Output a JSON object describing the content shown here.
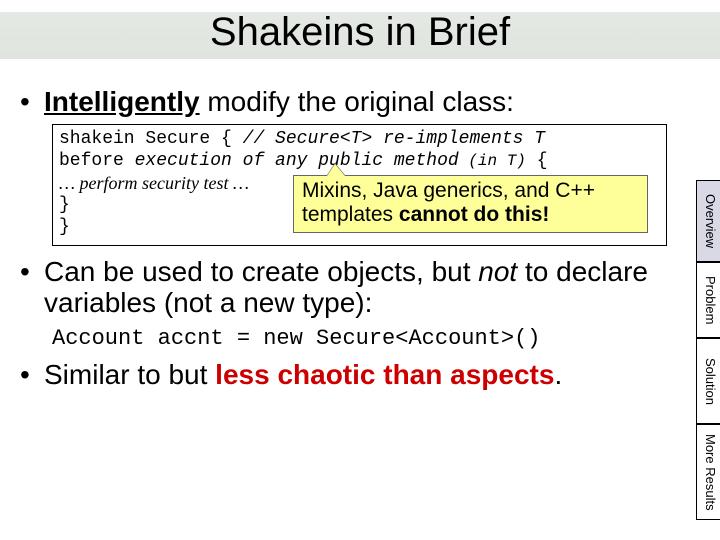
{
  "title": "Shakeins in Brief",
  "bullets": {
    "b1_pre": "Intelligently",
    "b1_post": " modify the original class:",
    "b2_pre": "Can be used to create objects, but ",
    "b2_em": "not",
    "b2_post": " to declare variables (not a new type):",
    "b3_pre": "Similar to but ",
    "b3_red": "less chaotic than aspects",
    "b3_post": "."
  },
  "code": {
    "l1a": "shakein Secure { ",
    "l1b": "// Secure<T> re-implements T",
    "l2a": "  before ",
    "l2b": "execution of any public method",
    "l2c": " (in T)",
    "l2d": " {",
    "l3": "    … perform security test …",
    "l4": "  }",
    "l5": "}"
  },
  "callout": {
    "line1": "Mixins, Java generics, and C++",
    "line2a": "templates ",
    "line2b": "cannot do this!"
  },
  "mono": "Account accnt = new Secure<Account>()",
  "tabs": {
    "overview": "Overview",
    "problem": "Problem",
    "solution": "Solution",
    "more": "More Results"
  }
}
